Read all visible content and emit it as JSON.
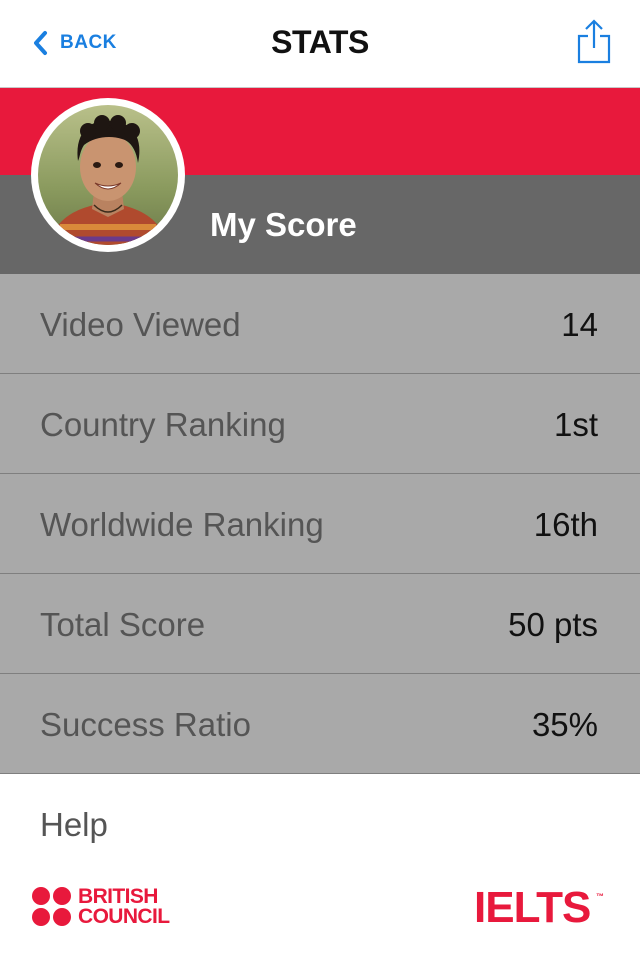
{
  "colors": {
    "accent_blue": "#1a7fe0",
    "brand_red": "#e8193c",
    "band_gray": "#676767",
    "row_gray": "#a9a9a9"
  },
  "navbar": {
    "back_label": "BACK",
    "title": "STATS",
    "back_icon": "chevron-left-icon",
    "share_icon": "share-icon"
  },
  "profile": {
    "title": "My Score",
    "avatar_icon": "avatar"
  },
  "stats": [
    {
      "label": "Video Viewed",
      "value": "14"
    },
    {
      "label": "Country Ranking",
      "value": "1st"
    },
    {
      "label": "Worldwide Ranking",
      "value": "16th"
    },
    {
      "label": "Total Score",
      "value": "50 pts"
    },
    {
      "label": "Success Ratio",
      "value": "35%"
    }
  ],
  "help_label": "Help",
  "footer": {
    "british_council_line1": "BRITISH",
    "british_council_line2": "COUNCIL",
    "ielts": "IELTS",
    "ielts_tm": "™"
  }
}
